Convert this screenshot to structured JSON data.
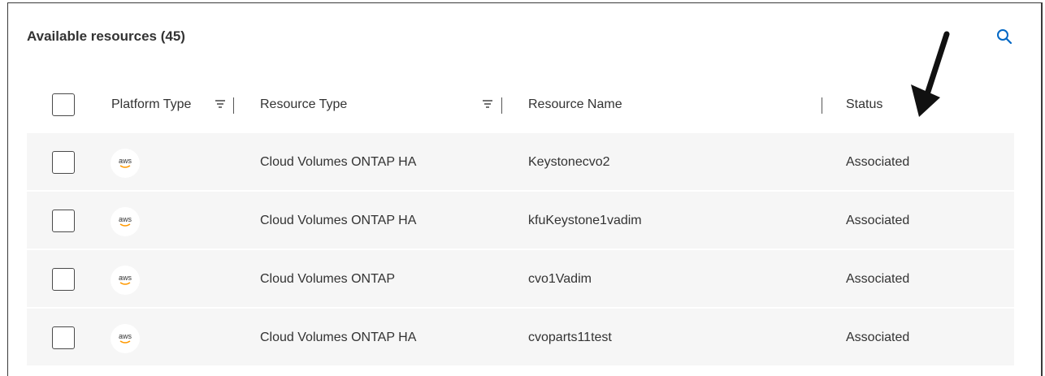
{
  "title": "Available resources (45)",
  "accent_color": "#0067c5",
  "icons": {
    "search": "search-icon",
    "filter": "filter-icon",
    "aws": "aws-logo-icon",
    "annotation": "arrow-annotation-icon"
  },
  "columns": {
    "platform_type": "Platform Type",
    "resource_type": "Resource Type",
    "resource_name": "Resource Name",
    "status": "Status"
  },
  "rows": [
    {
      "platform": "aws",
      "resource_type": "Cloud Volumes ONTAP HA",
      "resource_name": "Keystonecvo2",
      "status": "Associated"
    },
    {
      "platform": "aws",
      "resource_type": "Cloud Volumes ONTAP HA",
      "resource_name": "kfuKeystone1vadim",
      "status": "Associated"
    },
    {
      "platform": "aws",
      "resource_type": "Cloud Volumes ONTAP",
      "resource_name": "cvo1Vadim",
      "status": "Associated"
    },
    {
      "platform": "aws",
      "resource_type": "Cloud Volumes ONTAP HA",
      "resource_name": "cvoparts11test",
      "status": "Associated"
    }
  ]
}
